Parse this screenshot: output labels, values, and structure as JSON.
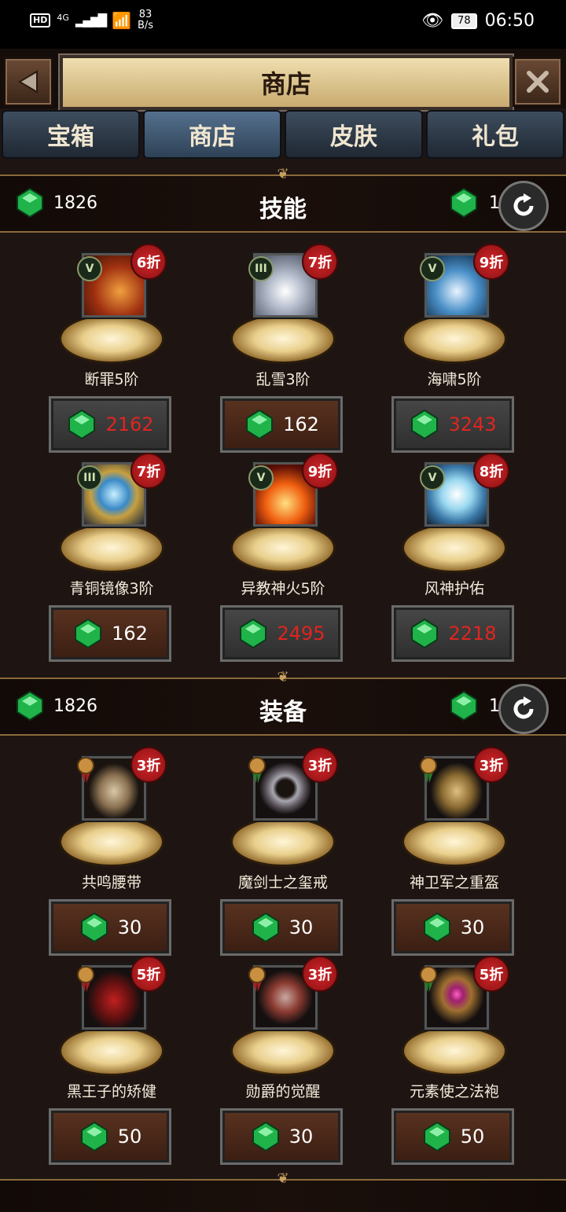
{
  "status": {
    "hd": "HD",
    "signal": "4G",
    "net_rate": "83",
    "net_unit": "B/s",
    "battery": "78",
    "time": "06:50"
  },
  "header": {
    "title": "商店"
  },
  "tabs": [
    {
      "label": "宝箱",
      "active": false
    },
    {
      "label": "商店",
      "active": true
    },
    {
      "label": "皮肤",
      "active": false
    },
    {
      "label": "礼包",
      "active": false
    }
  ],
  "sections": [
    {
      "title": "技能",
      "balance": "1826",
      "refresh_cost": "1",
      "items": [
        {
          "name": "断罪5阶",
          "discount": "6折",
          "rank": "V",
          "price": "2162",
          "price_color": "red"
        },
        {
          "name": "乱雪3阶",
          "discount": "7折",
          "rank": "III",
          "price": "162",
          "price_color": "white"
        },
        {
          "name": "海啸5阶",
          "discount": "9折",
          "rank": "V",
          "price": "3243",
          "price_color": "red"
        },
        {
          "name": "青铜镜像3阶",
          "discount": "7折",
          "rank": "III",
          "price": "162",
          "price_color": "white"
        },
        {
          "name": "异教神火5阶",
          "discount": "9折",
          "rank": "V",
          "price": "2495",
          "price_color": "red"
        },
        {
          "name": "风神护佑",
          "discount": "8折",
          "rank": "V",
          "price": "2218",
          "price_color": "red"
        }
      ]
    },
    {
      "title": "装备",
      "balance": "1826",
      "refresh_cost": "1",
      "items": [
        {
          "name": "共鸣腰带",
          "discount": "3折",
          "price": "30",
          "price_color": "white"
        },
        {
          "name": "魔剑士之玺戒",
          "discount": "3折",
          "price": "30",
          "price_color": "white"
        },
        {
          "name": "神卫军之重盔",
          "discount": "3折",
          "price": "30",
          "price_color": "white"
        },
        {
          "name": "黑王子的矫健",
          "discount": "5折",
          "price": "50",
          "price_color": "white"
        },
        {
          "name": "勋爵的觉醒",
          "discount": "3折",
          "price": "30",
          "price_color": "white"
        },
        {
          "name": "元素使之法袍",
          "discount": "5折",
          "price": "50",
          "price_color": "white"
        }
      ]
    }
  ],
  "colors": {
    "price_red": "#e0251f",
    "discount_badge": "#c81f22",
    "gem": "#1fb34a"
  }
}
